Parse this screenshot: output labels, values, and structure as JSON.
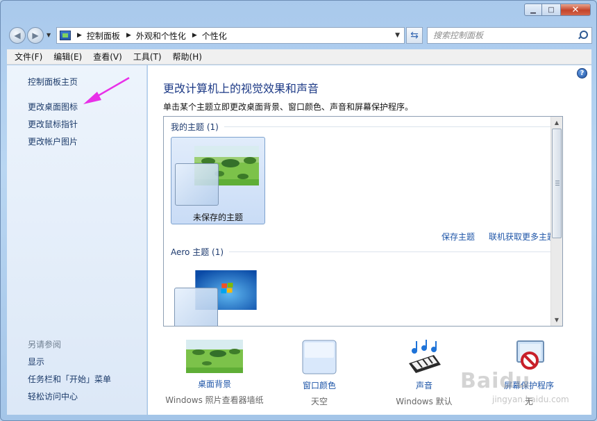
{
  "titlebar": {
    "minimize_symbol": "▁",
    "maximize_symbol": "□",
    "close_symbol": "✕"
  },
  "navigation": {
    "back_icon": "back-arrow-icon",
    "forward_icon": "forward-arrow-icon",
    "breadcrumbs": [
      "控制面板",
      "外观和个性化",
      "个性化"
    ],
    "search_placeholder": "搜索控制面板"
  },
  "menubar": {
    "items": [
      "文件(F)",
      "编辑(E)",
      "查看(V)",
      "工具(T)",
      "帮助(H)"
    ]
  },
  "sidebar": {
    "links": [
      "控制面板主页",
      "更改桌面图标",
      "更改鼠标指针",
      "更改帐户图片"
    ],
    "see_also_heading": "另请参阅",
    "see_also_links": [
      "显示",
      "任务栏和「开始」菜单",
      "轻松访问中心"
    ],
    "annotation_color": "#e830e8"
  },
  "main": {
    "title": "更改计算机上的视觉效果和声音",
    "description": "单击某个主题立即更改桌面背景、窗口颜色、声音和屏幕保护程序。",
    "my_themes_heading": "我的主题 (1)",
    "unsaved_theme_label": "未保存的主题",
    "save_theme_link": "保存主题",
    "more_themes_link": "联机获取更多主题",
    "aero_heading": "Aero 主题 (1)",
    "help_symbol": "?"
  },
  "bottom_bar": {
    "items": [
      {
        "label": "桌面背景",
        "sub": "Windows 照片查看器墙纸"
      },
      {
        "label": "窗口颜色",
        "sub": "天空"
      },
      {
        "label": "声音",
        "sub": "Windows 默认"
      },
      {
        "label": "屏幕保护程序",
        "sub": "无"
      }
    ]
  },
  "watermark": {
    "brand": "Baidu",
    "url": "jingyan.baidu.com"
  },
  "colors": {
    "link": "#1f56a8",
    "title": "#1d3a86",
    "sidebar_bg": "#e4eef9",
    "selection": "#c9dcf6"
  }
}
